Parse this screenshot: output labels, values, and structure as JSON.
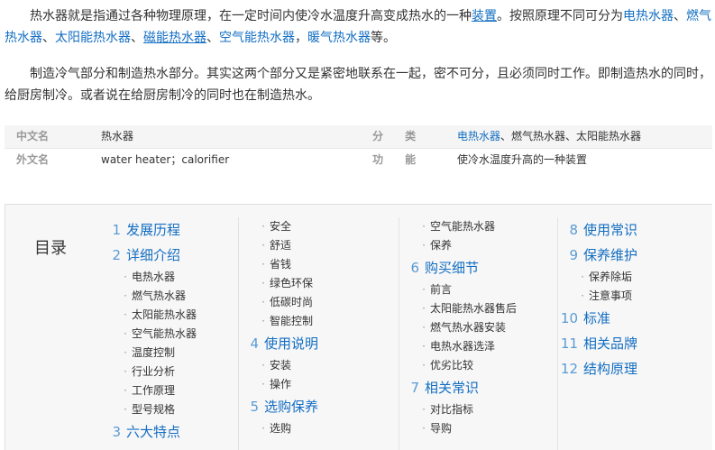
{
  "intro": {
    "p1_a": "热水器就是指通过各种物理原理，在一定时间内使冷水温度升高变成热水的一种",
    "p1_link_device": "装置",
    "p1_b": "。按照原理不同可分为",
    "p1_type1": "电热水器",
    "p1_sep1": "、",
    "p1_type2": "燃气热水器",
    "p1_sep2": "、",
    "p1_type3": "太阳能热水器",
    "p1_sep3": "、",
    "p1_type4": "磁能热水器",
    "p1_sep4": "、",
    "p1_type5": "空气能热水器",
    "p1_sep5": "，",
    "p1_type6": "暖气热水器",
    "p1_end": "等。",
    "p2": "制造冷气部分和制造热水部分。其实这两个部分又是紧密地联系在一起，密不可分，且必须同时工作。即制造热水的同时，给厨房制冷。或者说在给厨房制冷的同时也在制造热水。"
  },
  "basic_info": {
    "row1": {
      "label1": "中文名",
      "value1": "热水器",
      "label2": "分  类",
      "value2_link": "电热水器",
      "value2_rest": "、燃气热水器、太阳能热水器"
    },
    "row2": {
      "label1": "外文名",
      "value1": "water heater；calorifier",
      "label2": "功  能",
      "value2": "使冷水温度升高的一种装置"
    }
  },
  "toc": {
    "title": "目录",
    "col1": [
      {
        "type": "l1",
        "num": "1",
        "text": "发展历程"
      },
      {
        "type": "l1",
        "num": "2",
        "text": "详细介绍"
      },
      {
        "type": "l2",
        "text": "电热水器"
      },
      {
        "type": "l2",
        "text": "燃气热水器"
      },
      {
        "type": "l2",
        "text": "太阳能热水器"
      },
      {
        "type": "l2",
        "text": "空气能热水器"
      },
      {
        "type": "l2",
        "text": "温度控制"
      },
      {
        "type": "l2",
        "text": "行业分析"
      },
      {
        "type": "l2",
        "text": "工作原理"
      },
      {
        "type": "l2",
        "text": "型号规格"
      },
      {
        "type": "l1",
        "num": "3",
        "text": "六大特点"
      }
    ],
    "col2": [
      {
        "type": "l2",
        "text": "安全"
      },
      {
        "type": "l2",
        "text": "舒适"
      },
      {
        "type": "l2",
        "text": "省钱"
      },
      {
        "type": "l2",
        "text": "绿色环保"
      },
      {
        "type": "l2",
        "text": "低碳时尚"
      },
      {
        "type": "l2",
        "text": "智能控制"
      },
      {
        "type": "l1",
        "num": "4",
        "text": "使用说明"
      },
      {
        "type": "l2",
        "text": "安装"
      },
      {
        "type": "l2",
        "text": "操作"
      },
      {
        "type": "l1",
        "num": "5",
        "text": "选购保养"
      },
      {
        "type": "l2",
        "text": "选购"
      }
    ],
    "col3": [
      {
        "type": "l2",
        "text": "空气能热水器"
      },
      {
        "type": "l2",
        "text": "保养"
      },
      {
        "type": "l1",
        "num": "6",
        "text": "购买细节"
      },
      {
        "type": "l2",
        "text": "前言"
      },
      {
        "type": "l2",
        "text": "太阳能热水器售后"
      },
      {
        "type": "l2",
        "text": "燃气热水器安装"
      },
      {
        "type": "l2",
        "text": "电热水器选泽"
      },
      {
        "type": "l2",
        "text": "优劣比较"
      },
      {
        "type": "l1",
        "num": "7",
        "text": "相关常识"
      },
      {
        "type": "l2",
        "text": "对比指标"
      },
      {
        "type": "l2",
        "text": "导购"
      }
    ],
    "col4": [
      {
        "type": "l1",
        "num": "8",
        "text": "使用常识"
      },
      {
        "type": "l1",
        "num": "9",
        "text": "保养维护"
      },
      {
        "type": "l2",
        "text": "保养除垢"
      },
      {
        "type": "l2",
        "text": "注意事项"
      },
      {
        "type": "l1",
        "num": "10",
        "text": "标准"
      },
      {
        "type": "l1",
        "num": "11",
        "text": "相关品牌"
      },
      {
        "type": "l1",
        "num": "12",
        "text": "结构原理"
      }
    ]
  }
}
